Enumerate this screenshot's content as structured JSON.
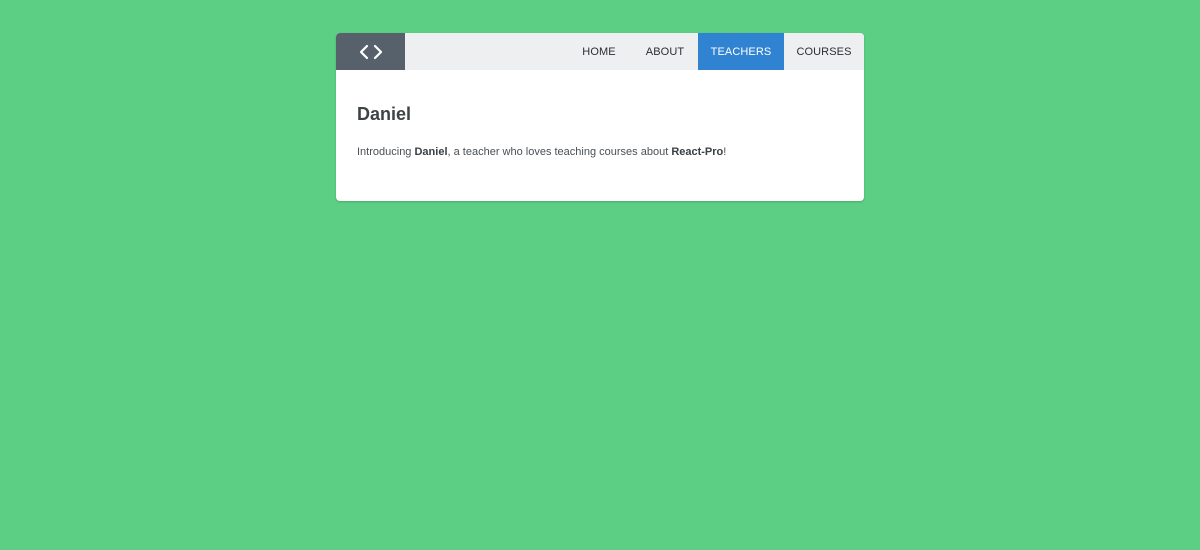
{
  "nav": {
    "logo_icon": "code-brackets-icon",
    "items": [
      {
        "label": "HOME",
        "active": false
      },
      {
        "label": "ABOUT",
        "active": false
      },
      {
        "label": "TEACHERS",
        "active": true
      },
      {
        "label": "COURSES",
        "active": false
      }
    ]
  },
  "teacher": {
    "name": "Daniel",
    "intro_prefix": "Introducing ",
    "intro_name": "Daniel",
    "intro_middle": ", a teacher who loves teaching courses about ",
    "intro_course": "React-Pro",
    "intro_suffix": "!"
  },
  "colors": {
    "background": "#5ccf84",
    "nav_background": "#eeeff1",
    "logo_background": "#56616b",
    "active_tab": "#3083d0"
  }
}
